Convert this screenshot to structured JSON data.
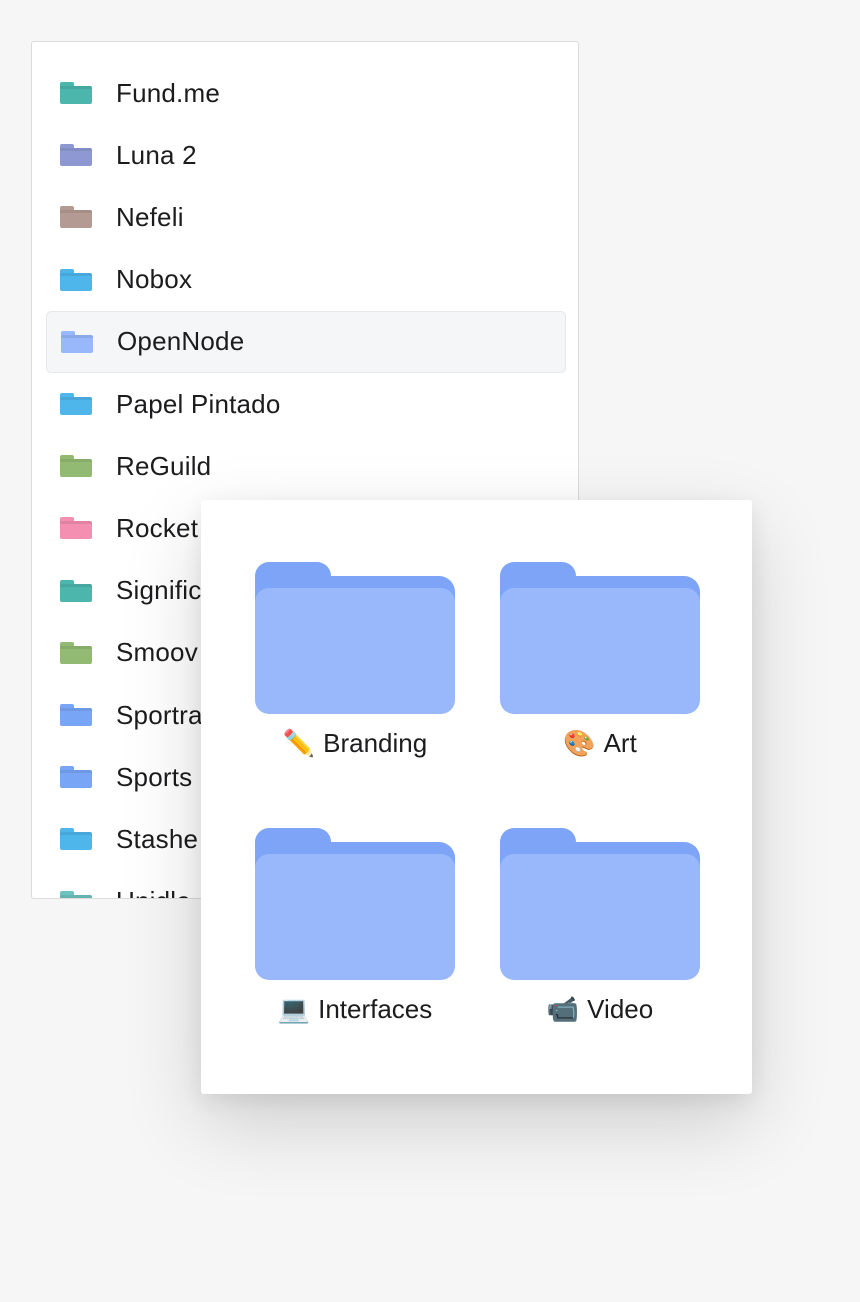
{
  "folder_list": {
    "items": [
      {
        "label": "Fund.me",
        "color": "#4db6ac"
      },
      {
        "label": "Luna 2",
        "color": "#8e99d3"
      },
      {
        "label": "Nefeli",
        "color": "#b39b93"
      },
      {
        "label": "Nobox",
        "color": "#4fb6ec"
      },
      {
        "label": "OpenNode",
        "color": "#98b8fb",
        "selected": true
      },
      {
        "label": "Papel Pintado",
        "color": "#4fb6ec"
      },
      {
        "label": "ReGuild",
        "color": "#93ba72"
      },
      {
        "label": "Rocket",
        "color": "#f48fb1"
      },
      {
        "label": "Signific",
        "color": "#4db6ac"
      },
      {
        "label": "Smoov",
        "color": "#93ba72"
      },
      {
        "label": "Sportra",
        "color": "#79a5f7"
      },
      {
        "label": "Sports",
        "color": "#79a5f7"
      },
      {
        "label": "Stashe",
        "color": "#4fb6ec"
      },
      {
        "label": "Unidle",
        "color": "#6ec3c1"
      }
    ]
  },
  "popover": {
    "folder_color_back": "#7ea4f8",
    "folder_color_front": "#98b8fb",
    "tiles": [
      {
        "emoji": "✏️",
        "label": "Branding"
      },
      {
        "emoji": "🎨",
        "label": "Art"
      },
      {
        "emoji": "💻",
        "label": "Interfaces"
      },
      {
        "emoji": "📹",
        "label": "Video"
      }
    ]
  }
}
